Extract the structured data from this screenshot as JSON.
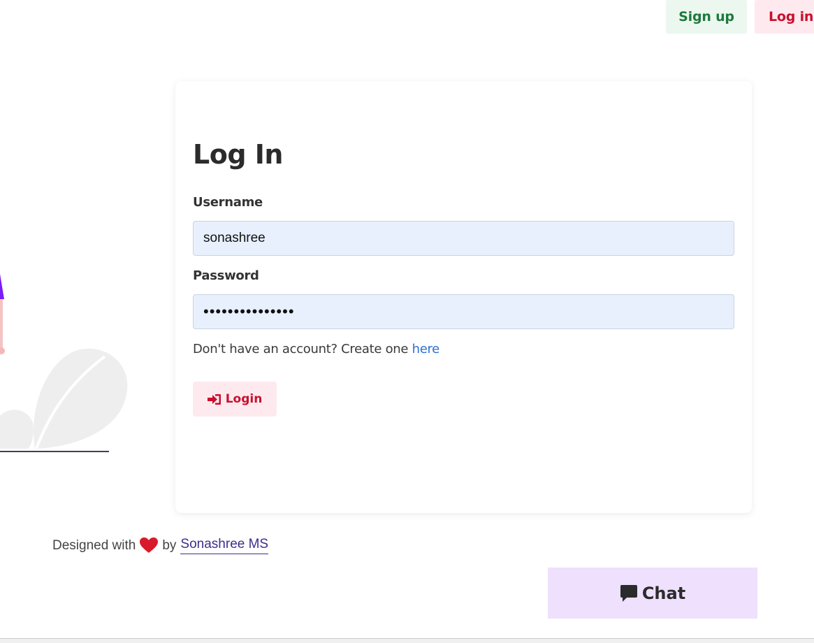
{
  "nav": {
    "signup_label": "Sign up",
    "login_label": "Log in"
  },
  "login_card": {
    "title": "Log In",
    "username_label": "Username",
    "username_value": "sonashree",
    "password_label": "Password",
    "password_value": "•••••••••••••••",
    "signup_prompt": "Don't have an account? Create one",
    "signup_link": "here",
    "submit_label": "Login",
    "submit_icon": "sign-in-icon"
  },
  "footer": {
    "prefix": "Designed with",
    "heart_icon": "heart-icon",
    "by": "by",
    "author": "Sonashree MS"
  },
  "chat": {
    "label": "Chat",
    "icon": "comment-icon"
  },
  "colors": {
    "signup_bg": "#ebf7ef",
    "signup_text": "#1d7a3d",
    "login_bg": "#fde9ee",
    "login_text": "#c8102e",
    "chat_bg": "#efe0fd",
    "input_bg": "#e8f0fe",
    "link": "#2f6fd1"
  }
}
